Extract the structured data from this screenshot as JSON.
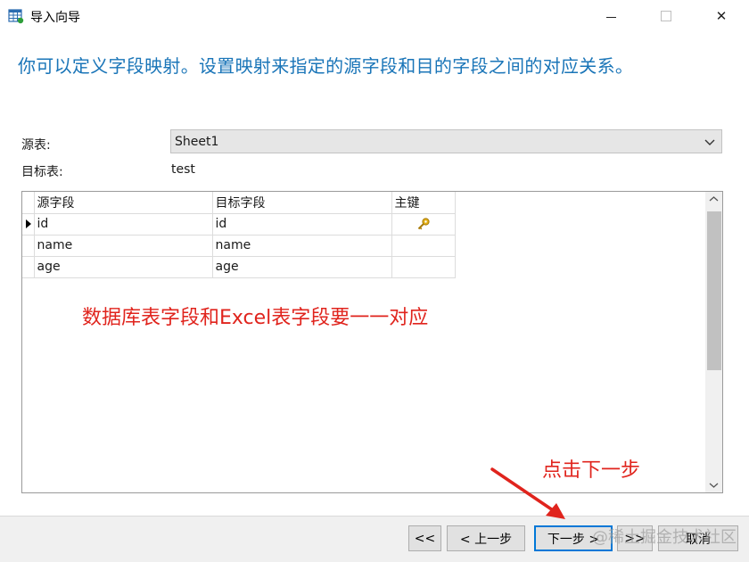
{
  "window": {
    "title": "导入向导",
    "minimize_icon": "minimize-icon",
    "maximize_icon": "maximize-icon",
    "close_icon": "close-icon",
    "close_glyph": "✕"
  },
  "heading": "你可以定义字段映射。设置映射来指定的源字段和目的字段之间的对应关系。",
  "source_table": {
    "label": "源表:",
    "value": "Sheet1"
  },
  "target_table": {
    "label": "目标表:",
    "value": "test"
  },
  "grid": {
    "columns": [
      "源字段",
      "目标字段",
      "主键"
    ],
    "rows": [
      {
        "source": "id",
        "target": "id",
        "primary_key": true,
        "current": true
      },
      {
        "source": "name",
        "target": "name",
        "primary_key": false,
        "current": false
      },
      {
        "source": "age",
        "target": "age",
        "primary_key": false,
        "current": false
      }
    ],
    "primary_key_icon": "key-icon"
  },
  "annotations": {
    "mapping_note": "数据库表字段和Excel表字段要一一对应",
    "next_note": "点击下一步"
  },
  "buttons": {
    "first": "<<",
    "prev": "< 上一步",
    "next": "下一步 >",
    "last": ">>",
    "cancel": "取消"
  },
  "watermark": "@稀土掘金技术社区",
  "colors": {
    "heading": "#1a75b8",
    "annotation": "#e0241d",
    "key": "#d4a017",
    "focus": "#0078d7"
  }
}
